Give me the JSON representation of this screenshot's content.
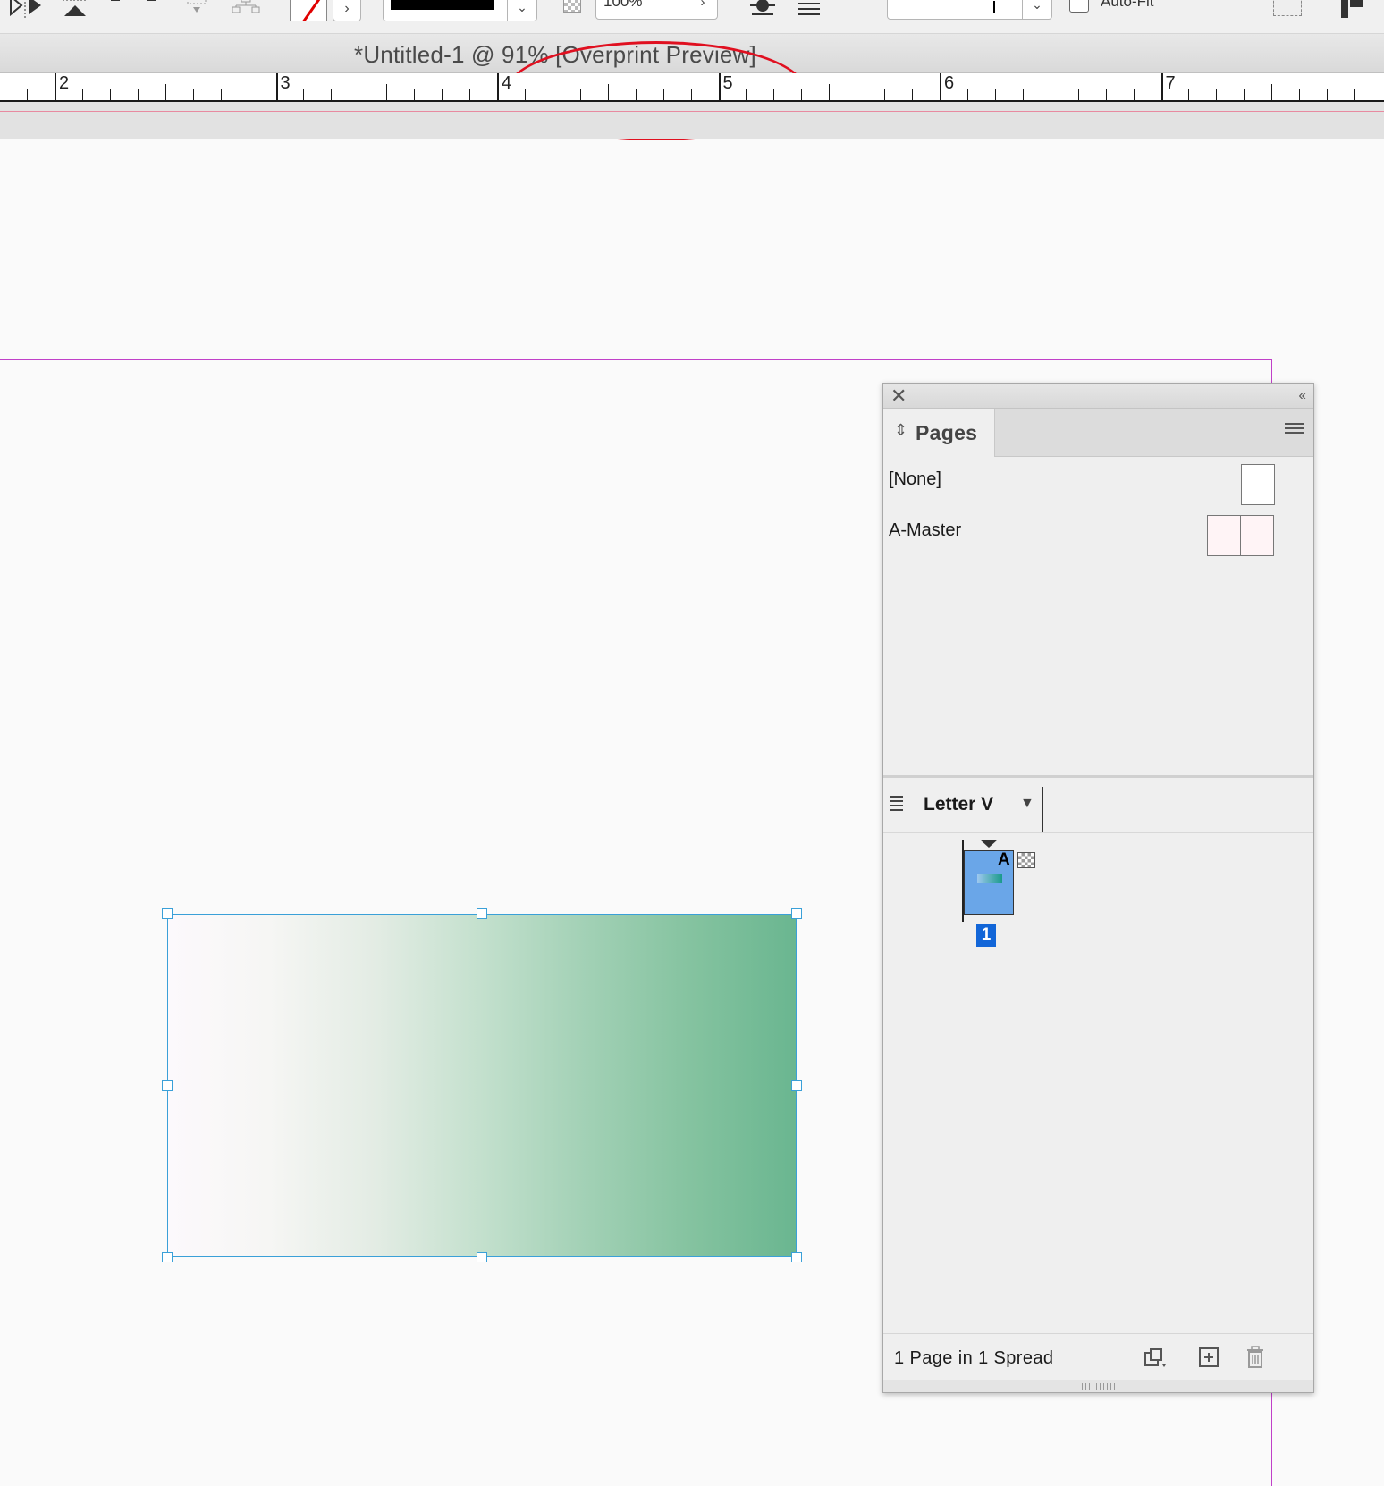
{
  "toolbar": {
    "opacity_value": "100%",
    "auto_fit_label": "Auto-Fit",
    "stroke_color": "#e00000"
  },
  "window": {
    "title": "*Untitled-1 @ 91% [Overprint Preview]"
  },
  "ruler": {
    "labels": [
      "2",
      "3",
      "4",
      "5",
      "6",
      "7"
    ]
  },
  "canvas": {
    "page_edge_color": "#c040c8",
    "selection_color": "#3aa0d8",
    "gradient_start_color": "#fcf9fc",
    "gradient_end_color": "#6ab690"
  },
  "pages_panel": {
    "tab_label": "Pages",
    "masters": [
      {
        "label": "[None]"
      },
      {
        "label": "A-Master"
      }
    ],
    "page_size_label": "Letter V",
    "page_master_letter": "A",
    "page_number": "1",
    "status_text": "1 Page in 1 Spread",
    "icons": {
      "close": "close-icon",
      "collapse": "collapse-icon",
      "menu": "panel-menu-icon",
      "edit_page_size": "edit-page-size-icon",
      "new_page": "new-page-icon",
      "delete": "trash-icon"
    }
  },
  "annotation": {
    "color": "#e01020"
  }
}
